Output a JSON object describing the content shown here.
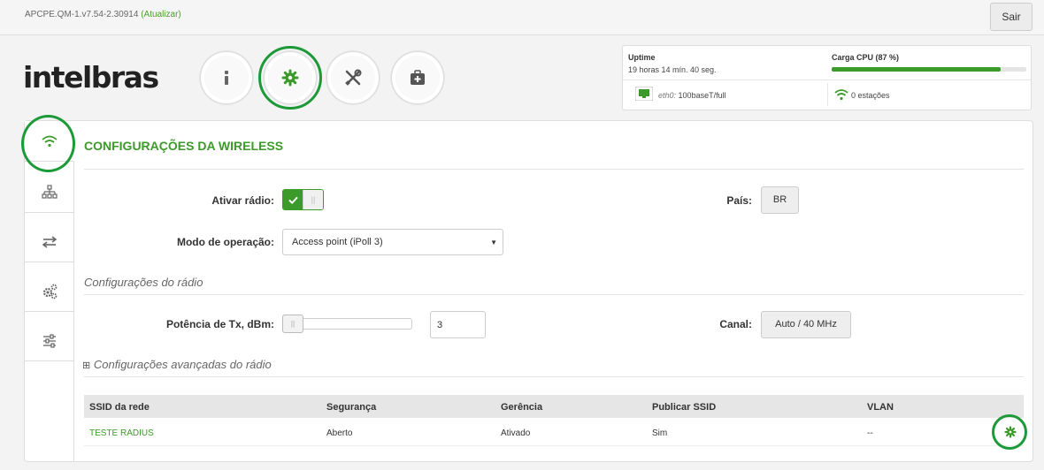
{
  "header": {
    "version": "APCPE.QM-1.v7.54-2.30914",
    "update_link": "(Atualizar)",
    "logout_label": "Sair",
    "logo_text": "intelbras"
  },
  "top_nav": [
    {
      "icon": "info-icon"
    },
    {
      "icon": "gear-icon",
      "active": true
    },
    {
      "icon": "tools-icon"
    },
    {
      "icon": "toolbox-icon"
    }
  ],
  "status": {
    "uptime_label": "Uptime",
    "uptime_value": "19 horas 14 mín. 40 seg.",
    "cpu_label": "Carga CPU (87 %)",
    "cpu_percent": 87,
    "eth_name": "eth0:",
    "eth_value": "100baseT/full",
    "stations_value": "0 estações"
  },
  "sidebar": [
    {
      "icon": "wifi-icon",
      "active": true
    },
    {
      "icon": "network-tree-icon"
    },
    {
      "icon": "transfer-arrows-icon"
    },
    {
      "icon": "gears-icon"
    },
    {
      "icon": "sliders-icon"
    }
  ],
  "wireless": {
    "title": "CONFIGURAÇÕES DA WIRELESS",
    "radio_label": "Ativar rádio:",
    "radio_enabled": true,
    "country_label": "País:",
    "country_value": "BR",
    "mode_label": "Modo de operação:",
    "mode_value": "Access point (iPoll 3)",
    "radio_section": "Configurações do rádio",
    "tx_label": "Potência de Tx, dBm:",
    "tx_value": "3",
    "channel_label": "Canal:",
    "channel_value": "Auto / 40 MHz",
    "advanced_toggle": "⊞",
    "advanced_label": "Configurações avançadas do rádio"
  },
  "ssid_table": {
    "headers": [
      "SSID da rede",
      "Segurança",
      "Gerência",
      "Publicar SSID",
      "VLAN"
    ],
    "rows": [
      {
        "ssid": "TESTE RADIUS",
        "security": "Aberto",
        "management": "Ativado",
        "publish": "Sim",
        "vlan": "--"
      }
    ]
  },
  "colors": {
    "accent": "#3c9a2a",
    "highlight_ring": "#1d9a38"
  }
}
